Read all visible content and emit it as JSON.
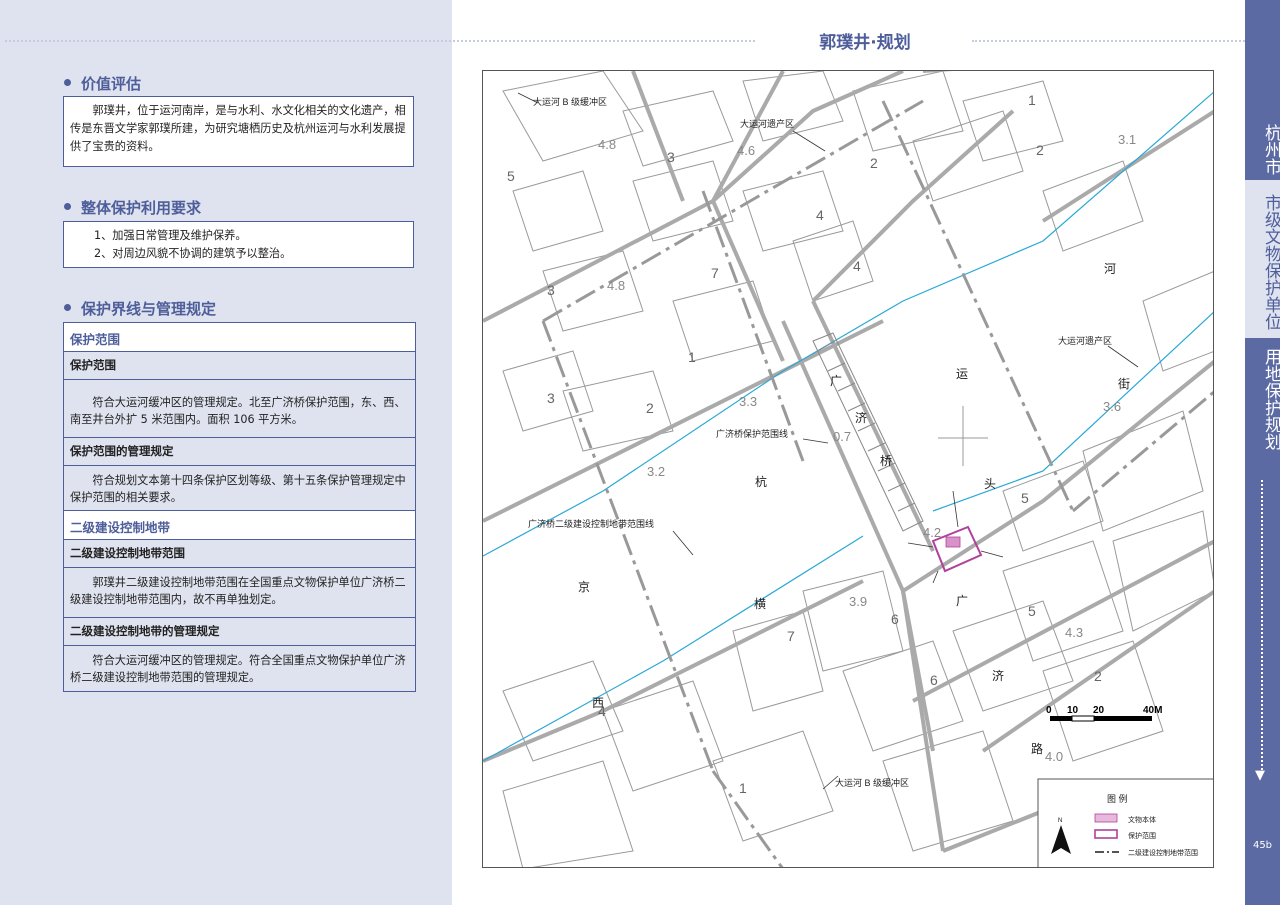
{
  "page_title": "郭璞井·规划",
  "sections": {
    "value": {
      "heading": "价值评估",
      "text": "郭璞井，位于运河南岸，是与水利、水文化相关的文化遗产，相传是东晋文学家郭璞所建，为研究塘栖历史及杭州运河与水利发展提供了宝贵的资料。"
    },
    "requirements": {
      "heading": "整体保护利用要求",
      "items": [
        "1、加强日常管理及维护保养。",
        "2、对周边风貌不协调的建筑予以整治。"
      ]
    },
    "boundaries": {
      "heading": "保护界线与管理规定",
      "protection_range_title": "保护范围",
      "protection_range_sub": "保护范围",
      "protection_range_text": "符合大运河缓冲区的管理规定。北至广济桥保护范围，东、西、南至井台外扩 5 米范围内。面积 106 平方米。",
      "protection_rules_sub": "保护范围的管理规定",
      "protection_rules_text": "符合规划文本第十四条保护区划等级、第十五条保护管理规定中保护范围的相关要求。",
      "control_title": "二级建设控制地带",
      "control_range_sub": "二级建设控制地带范围",
      "control_range_text": "郭璞井二级建设控制地带范围在全国重点文物保护单位广济桥二级建设控制地带范围内，故不再单独划定。",
      "control_rules_sub": "二级建设控制地带的管理规定",
      "control_rules_text": "符合大运河缓冲区的管理规定。符合全国重点文物保护单位广济桥二级建设控制地带范围的管理规定。"
    }
  },
  "sidebar": {
    "city": "杭州市",
    "category": "市级文物保护单位",
    "topic": "用地保护规划",
    "page_number": "45b"
  },
  "map": {
    "labels": {
      "buffer_b_top": "大运河 B 级缓冲区",
      "heritage_top": "大运河遗产区",
      "heritage_right": "大运河遗产区",
      "bridge_line": "广济桥保护范围线",
      "control_line": "广济桥二级建设控制地带范围线",
      "buffer_b_bottom": "大运河 B 级缓冲区"
    },
    "place_chars": {
      "he": "河",
      "yun": "运",
      "jie": "街",
      "tou": "头",
      "guang1": "广",
      "ji1": "济",
      "qiao": "桥",
      "hang": "杭",
      "jing": "京",
      "heng": "横",
      "xi": "西",
      "guang2": "广",
      "ji2": "济",
      "lu": "路"
    },
    "building_numbers": [
      "1",
      "2",
      "3",
      "4",
      "5",
      "6",
      "7"
    ],
    "elevations": [
      "4.8",
      "4.6",
      "4.8",
      "3.3",
      "3.2",
      "0.7",
      "3.6",
      "3.9",
      "4.3",
      "4.0",
      "4.2",
      "3.1"
    ],
    "scale": {
      "ticks": [
        "0",
        "10",
        "20",
        "40M"
      ]
    },
    "north": "N",
    "legend": {
      "title": "图 例",
      "items": [
        "文物本体",
        "保护范围",
        "二级建设控制地带范围"
      ]
    }
  },
  "colors": {
    "accent": "#4e5e9a",
    "panel": "#dfe3ef",
    "river": "#29a8d6",
    "protect": "#b0419a"
  }
}
